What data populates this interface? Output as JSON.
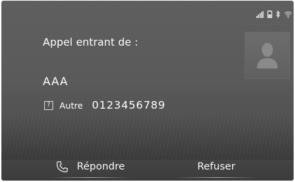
{
  "status_icons": [
    "signal-bars-icon",
    "phone-battery-icon",
    "bluetooth-icon",
    "wifi-icon"
  ],
  "call": {
    "header": "Appel entrant de :",
    "caller_name": "AAA",
    "number_type_icon": "?",
    "number_type": "Autre",
    "number": "0123456789",
    "avatar_icon": "contact-silhouette-icon"
  },
  "actions": {
    "answer_label": "Répondre",
    "answer_icon": "phone-handset-icon",
    "decline_label": "Refuser"
  }
}
